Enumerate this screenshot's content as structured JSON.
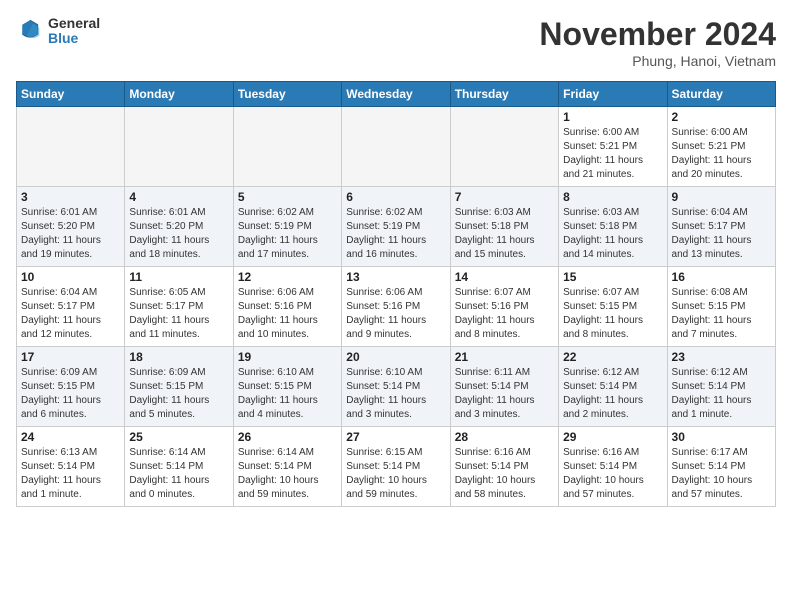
{
  "header": {
    "logo_general": "General",
    "logo_blue": "Blue",
    "month_title": "November 2024",
    "location": "Phung, Hanoi, Vietnam"
  },
  "weekdays": [
    "Sunday",
    "Monday",
    "Tuesday",
    "Wednesday",
    "Thursday",
    "Friday",
    "Saturday"
  ],
  "weeks": [
    [
      {
        "day": "",
        "detail": ""
      },
      {
        "day": "",
        "detail": ""
      },
      {
        "day": "",
        "detail": ""
      },
      {
        "day": "",
        "detail": ""
      },
      {
        "day": "",
        "detail": ""
      },
      {
        "day": "1",
        "detail": "Sunrise: 6:00 AM\nSunset: 5:21 PM\nDaylight: 11 hours\nand 21 minutes."
      },
      {
        "day": "2",
        "detail": "Sunrise: 6:00 AM\nSunset: 5:21 PM\nDaylight: 11 hours\nand 20 minutes."
      }
    ],
    [
      {
        "day": "3",
        "detail": "Sunrise: 6:01 AM\nSunset: 5:20 PM\nDaylight: 11 hours\nand 19 minutes."
      },
      {
        "day": "4",
        "detail": "Sunrise: 6:01 AM\nSunset: 5:20 PM\nDaylight: 11 hours\nand 18 minutes."
      },
      {
        "day": "5",
        "detail": "Sunrise: 6:02 AM\nSunset: 5:19 PM\nDaylight: 11 hours\nand 17 minutes."
      },
      {
        "day": "6",
        "detail": "Sunrise: 6:02 AM\nSunset: 5:19 PM\nDaylight: 11 hours\nand 16 minutes."
      },
      {
        "day": "7",
        "detail": "Sunrise: 6:03 AM\nSunset: 5:18 PM\nDaylight: 11 hours\nand 15 minutes."
      },
      {
        "day": "8",
        "detail": "Sunrise: 6:03 AM\nSunset: 5:18 PM\nDaylight: 11 hours\nand 14 minutes."
      },
      {
        "day": "9",
        "detail": "Sunrise: 6:04 AM\nSunset: 5:17 PM\nDaylight: 11 hours\nand 13 minutes."
      }
    ],
    [
      {
        "day": "10",
        "detail": "Sunrise: 6:04 AM\nSunset: 5:17 PM\nDaylight: 11 hours\nand 12 minutes."
      },
      {
        "day": "11",
        "detail": "Sunrise: 6:05 AM\nSunset: 5:17 PM\nDaylight: 11 hours\nand 11 minutes."
      },
      {
        "day": "12",
        "detail": "Sunrise: 6:06 AM\nSunset: 5:16 PM\nDaylight: 11 hours\nand 10 minutes."
      },
      {
        "day": "13",
        "detail": "Sunrise: 6:06 AM\nSunset: 5:16 PM\nDaylight: 11 hours\nand 9 minutes."
      },
      {
        "day": "14",
        "detail": "Sunrise: 6:07 AM\nSunset: 5:16 PM\nDaylight: 11 hours\nand 8 minutes."
      },
      {
        "day": "15",
        "detail": "Sunrise: 6:07 AM\nSunset: 5:15 PM\nDaylight: 11 hours\nand 8 minutes."
      },
      {
        "day": "16",
        "detail": "Sunrise: 6:08 AM\nSunset: 5:15 PM\nDaylight: 11 hours\nand 7 minutes."
      }
    ],
    [
      {
        "day": "17",
        "detail": "Sunrise: 6:09 AM\nSunset: 5:15 PM\nDaylight: 11 hours\nand 6 minutes."
      },
      {
        "day": "18",
        "detail": "Sunrise: 6:09 AM\nSunset: 5:15 PM\nDaylight: 11 hours\nand 5 minutes."
      },
      {
        "day": "19",
        "detail": "Sunrise: 6:10 AM\nSunset: 5:15 PM\nDaylight: 11 hours\nand 4 minutes."
      },
      {
        "day": "20",
        "detail": "Sunrise: 6:10 AM\nSunset: 5:14 PM\nDaylight: 11 hours\nand 3 minutes."
      },
      {
        "day": "21",
        "detail": "Sunrise: 6:11 AM\nSunset: 5:14 PM\nDaylight: 11 hours\nand 3 minutes."
      },
      {
        "day": "22",
        "detail": "Sunrise: 6:12 AM\nSunset: 5:14 PM\nDaylight: 11 hours\nand 2 minutes."
      },
      {
        "day": "23",
        "detail": "Sunrise: 6:12 AM\nSunset: 5:14 PM\nDaylight: 11 hours\nand 1 minute."
      }
    ],
    [
      {
        "day": "24",
        "detail": "Sunrise: 6:13 AM\nSunset: 5:14 PM\nDaylight: 11 hours\nand 1 minute."
      },
      {
        "day": "25",
        "detail": "Sunrise: 6:14 AM\nSunset: 5:14 PM\nDaylight: 11 hours\nand 0 minutes."
      },
      {
        "day": "26",
        "detail": "Sunrise: 6:14 AM\nSunset: 5:14 PM\nDaylight: 10 hours\nand 59 minutes."
      },
      {
        "day": "27",
        "detail": "Sunrise: 6:15 AM\nSunset: 5:14 PM\nDaylight: 10 hours\nand 59 minutes."
      },
      {
        "day": "28",
        "detail": "Sunrise: 6:16 AM\nSunset: 5:14 PM\nDaylight: 10 hours\nand 58 minutes."
      },
      {
        "day": "29",
        "detail": "Sunrise: 6:16 AM\nSunset: 5:14 PM\nDaylight: 10 hours\nand 57 minutes."
      },
      {
        "day": "30",
        "detail": "Sunrise: 6:17 AM\nSunset: 5:14 PM\nDaylight: 10 hours\nand 57 minutes."
      }
    ]
  ]
}
